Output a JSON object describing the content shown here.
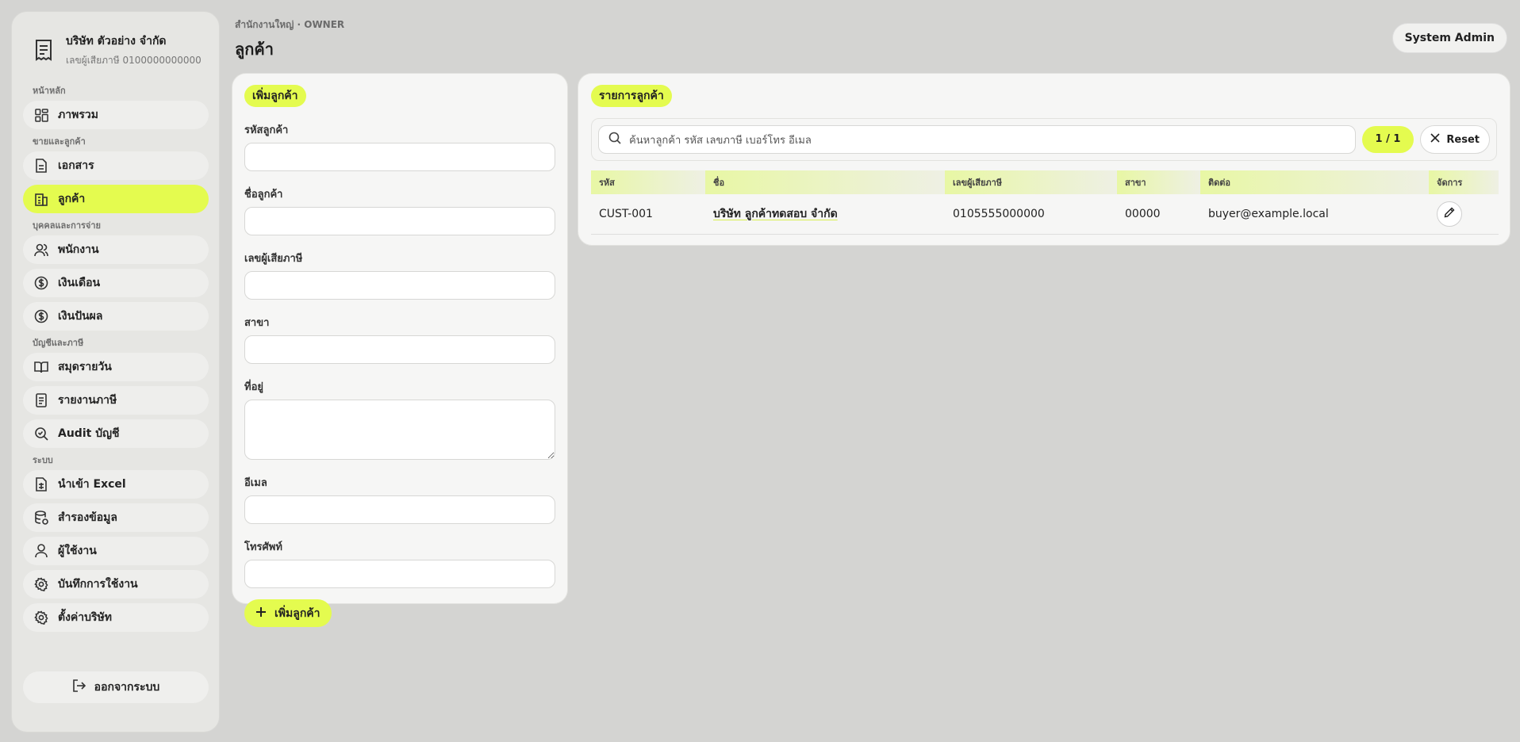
{
  "company": {
    "name": "บริษัท ตัวอย่าง จำกัด",
    "tax_id": "เลขผู้เสียภาษี 0100000000000"
  },
  "sidebar": {
    "sections": [
      {
        "label": "หน้าหลัก",
        "items": [
          {
            "label": "ภาพรวม",
            "icon": "grid-icon"
          }
        ]
      },
      {
        "label": "ขายและลูกค้า",
        "items": [
          {
            "label": "เอกสาร",
            "icon": "document-icon"
          },
          {
            "label": "ลูกค้า",
            "icon": "building-icon",
            "active": true
          }
        ]
      },
      {
        "label": "บุคคลและการจ่าย",
        "items": [
          {
            "label": "พนักงาน",
            "icon": "users-icon"
          },
          {
            "label": "เงินเดือน",
            "icon": "dollar-icon"
          },
          {
            "label": "เงินปันผล",
            "icon": "dollar-icon"
          }
        ]
      },
      {
        "label": "บัญชีและภาษี",
        "items": [
          {
            "label": "สมุดรายวัน",
            "icon": "book-icon"
          },
          {
            "label": "รายงานภาษี",
            "icon": "report-icon"
          },
          {
            "label": "Audit บัญชี",
            "icon": "audit-icon"
          }
        ]
      },
      {
        "label": "ระบบ",
        "items": [
          {
            "label": "นำเข้า Excel",
            "icon": "spreadsheet-icon"
          },
          {
            "label": "สำรองข้อมูล",
            "icon": "database-icon"
          },
          {
            "label": "ผู้ใช้งาน",
            "icon": "user-icon"
          },
          {
            "label": "บันทึกการใช้งาน",
            "icon": "gear-icon"
          },
          {
            "label": "ตั้งค่าบริษัท",
            "icon": "gear-icon"
          }
        ]
      }
    ],
    "logout": "ออกจากระบบ"
  },
  "header": {
    "breadcrumb": "สำนักงานใหญ่ · OWNER",
    "title": "ลูกค้า",
    "user": "System Admin"
  },
  "form": {
    "title": "เพิ่มลูกค้า",
    "fields": [
      "รหัสลูกค้า",
      "ชื่อลูกค้า",
      "เลขผู้เสียภาษี",
      "สาขา",
      "ที่อยู่",
      "อีเมล",
      "โทรศัพท์"
    ],
    "submit": "เพิ่มลูกค้า"
  },
  "list": {
    "title": "รายการลูกค้า",
    "search_placeholder": "ค้นหาลูกค้า รหัส เลขภาษี เบอร์โทร อีเมล",
    "count": "1 / 1",
    "reset": "Reset",
    "columns": [
      "รหัส",
      "ชื่อ",
      "เลขผู้เสียภาษี",
      "สาขา",
      "ติดต่อ",
      "จัดการ"
    ],
    "rows": [
      {
        "code": "CUST-001",
        "name": "บริษัท ลูกค้าทดสอบ จำกัด",
        "tax_id": "0105555000000",
        "branch": "00000",
        "contact": "buyer@example.local"
      }
    ]
  },
  "colors": {
    "accent": "#e4fb4f",
    "background": "#d4d4d2"
  }
}
